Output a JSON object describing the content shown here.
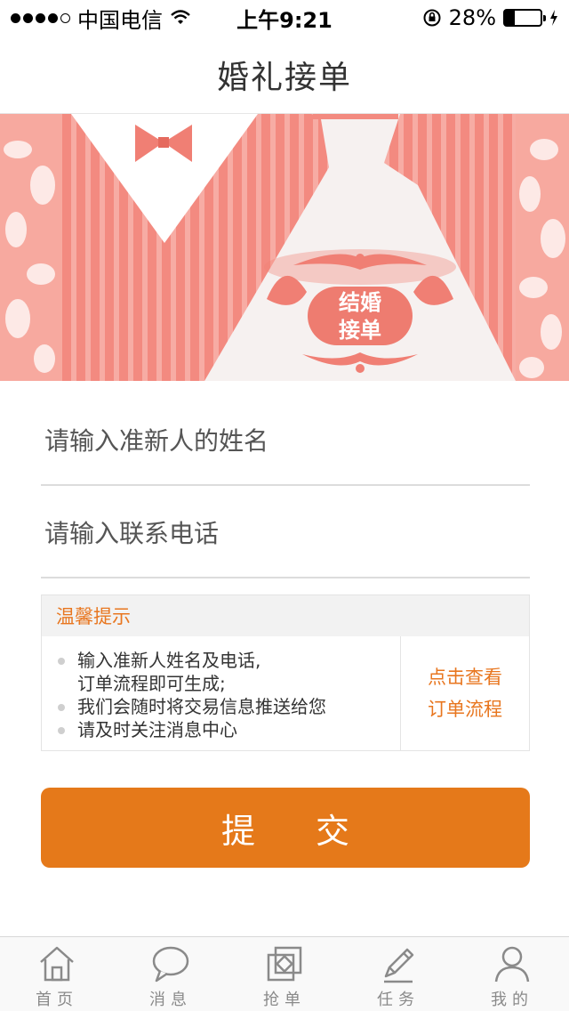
{
  "status": {
    "carrier": "中国电信",
    "time": "上午9:21",
    "battery_percent": "28%",
    "battery_level": 0.28
  },
  "nav": {
    "title": "婚礼接单"
  },
  "banner": {
    "badge_line1": "结婚",
    "badge_line2": "接单"
  },
  "form": {
    "name_placeholder": "请输入准新人的姓名",
    "phone_placeholder": "请输入联系电话",
    "name_value": "",
    "phone_value": ""
  },
  "tips": {
    "title": "温馨提示",
    "items": [
      {
        "line1": "输入准新人姓名及电话,",
        "line2": "订单流程即可生成;"
      },
      {
        "line1": "我们会随时将交易信息推送给您"
      },
      {
        "line1": "请及时关注消息中心"
      }
    ],
    "link_line1": "点击查看",
    "link_line2": "订单流程"
  },
  "submit_label": "提 交",
  "tabs": [
    {
      "label": "首页",
      "icon": "home-icon"
    },
    {
      "label": "消息",
      "icon": "message-icon"
    },
    {
      "label": "抢单",
      "icon": "grab-order-icon"
    },
    {
      "label": "任务",
      "icon": "task-icon"
    },
    {
      "label": "我的",
      "icon": "profile-icon"
    }
  ],
  "colors": {
    "accent": "#e5791a",
    "banner_pink": "#f38a80",
    "tab_gray": "#8a8a8a"
  }
}
